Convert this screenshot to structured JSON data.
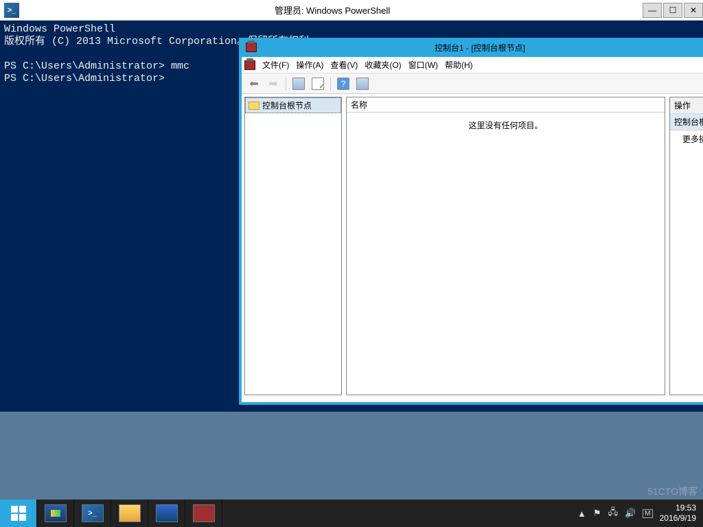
{
  "powershell": {
    "title": "管理员: Windows PowerShell",
    "body": "Windows PowerShell\n版权所有 (C) 2013 Microsoft Corporation。保留所有权利。\n\nPS C:\\Users\\Administrator> mmc\nPS C:\\Users\\Administrator>"
  },
  "mmc": {
    "title": "控制台1 - [控制台根节点]",
    "menu": {
      "file": "文件(F)",
      "action": "操作(A)",
      "view": "查看(V)",
      "favorites": "收藏夹(O)",
      "window": "窗口(W)",
      "help": "帮助(H)"
    },
    "tree_root": "控制台根节点",
    "list_header": "名称",
    "empty_msg": "这里没有任何项目。",
    "actions": {
      "header": "操作",
      "subheader": "控制台根节点",
      "more": "更多操作"
    }
  },
  "taskbar": {
    "tray_up": "▲",
    "clock_time": "19:53",
    "clock_date": "2016/9/19"
  },
  "watermark": "51CTO博客"
}
